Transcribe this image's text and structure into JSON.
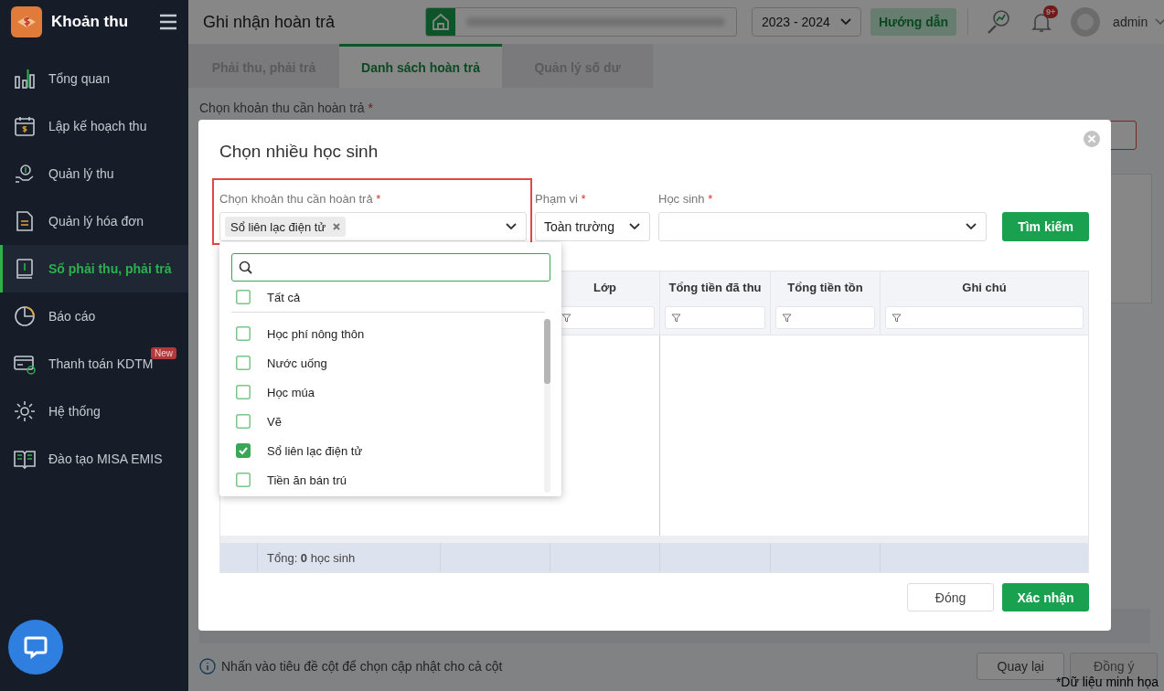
{
  "sidebar": {
    "app_title": "Khoản thu",
    "items": [
      {
        "label": "Tổng quan",
        "selected": false
      },
      {
        "label": "Lập kế hoạch thu",
        "selected": false
      },
      {
        "label": "Quản lý thu",
        "selected": false
      },
      {
        "label": "Quản lý hóa đơn",
        "selected": false
      },
      {
        "label": "Sổ phải thu, phải trả",
        "selected": true
      },
      {
        "label": "Báo cáo",
        "selected": false
      },
      {
        "label": "Thanh toán KDTM",
        "selected": false,
        "badge": "New"
      },
      {
        "label": "Hệ thống",
        "selected": false
      },
      {
        "label": "Đào tạo MISA EMIS",
        "selected": false
      }
    ]
  },
  "header": {
    "title": "Ghi nhận hoàn trả",
    "school_year": "2023 - 2024",
    "guide_button": "Hướng dẫn",
    "notification_count": "9+",
    "user_name": "admin"
  },
  "tabs": [
    {
      "label": "Phải thu, phải trả",
      "selected": false
    },
    {
      "label": "Danh sách hoàn trả",
      "selected": true
    },
    {
      "label": "Quản lý số dư",
      "selected": false
    }
  ],
  "page": {
    "field": {
      "label": "Chọn khoản thu cần hoàn trả",
      "required_mark": "*"
    },
    "hint": "Nhấn vào tiêu đề cột để chọn cập nhật cho cả cột",
    "buttons": [
      {
        "label": "Quay lại",
        "disabled": false
      },
      {
        "label": "Đồng ý",
        "disabled": true
      }
    ]
  },
  "modal": {
    "title": "Chọn nhiều học sinh",
    "filters": [
      {
        "kind": "multiselect",
        "label": "Chọn khoản thu cần hoàn trả",
        "required_mark": "*",
        "highlighted": true,
        "tags": [
          "Sổ liên lạc điện tử"
        ]
      },
      {
        "kind": "select",
        "label": "Phạm vi",
        "required_mark": "*",
        "value": "Toàn trường"
      },
      {
        "kind": "select",
        "label": "Học sinh",
        "required_mark": "*"
      }
    ],
    "search_button": "Tìm kiếm",
    "dropdown": {
      "select_all": {
        "label": "Tất cả",
        "checked": false
      },
      "options": [
        {
          "label": "Học phí nông thôn",
          "checked": false
        },
        {
          "label": "Nước uống",
          "checked": false
        },
        {
          "label": "Học múa",
          "checked": false
        },
        {
          "label": "Vẽ",
          "checked": false
        },
        {
          "label": "Sổ liên lạc điện tử",
          "checked": true
        },
        {
          "label": "Tiền ăn bán trú",
          "checked": false
        }
      ]
    },
    "table": {
      "columns": [
        "Lớp",
        "Tổng tiền đã thu",
        "Tổng tiền tồn",
        "Ghi chú"
      ],
      "total": "Tổng: **0** học sinh"
    },
    "buttons": [
      {
        "label": "Đóng",
        "kind": "secondary"
      },
      {
        "label": "Xác nhận",
        "kind": "primary"
      }
    ]
  },
  "note": "*Dữ liệu minh họa"
}
